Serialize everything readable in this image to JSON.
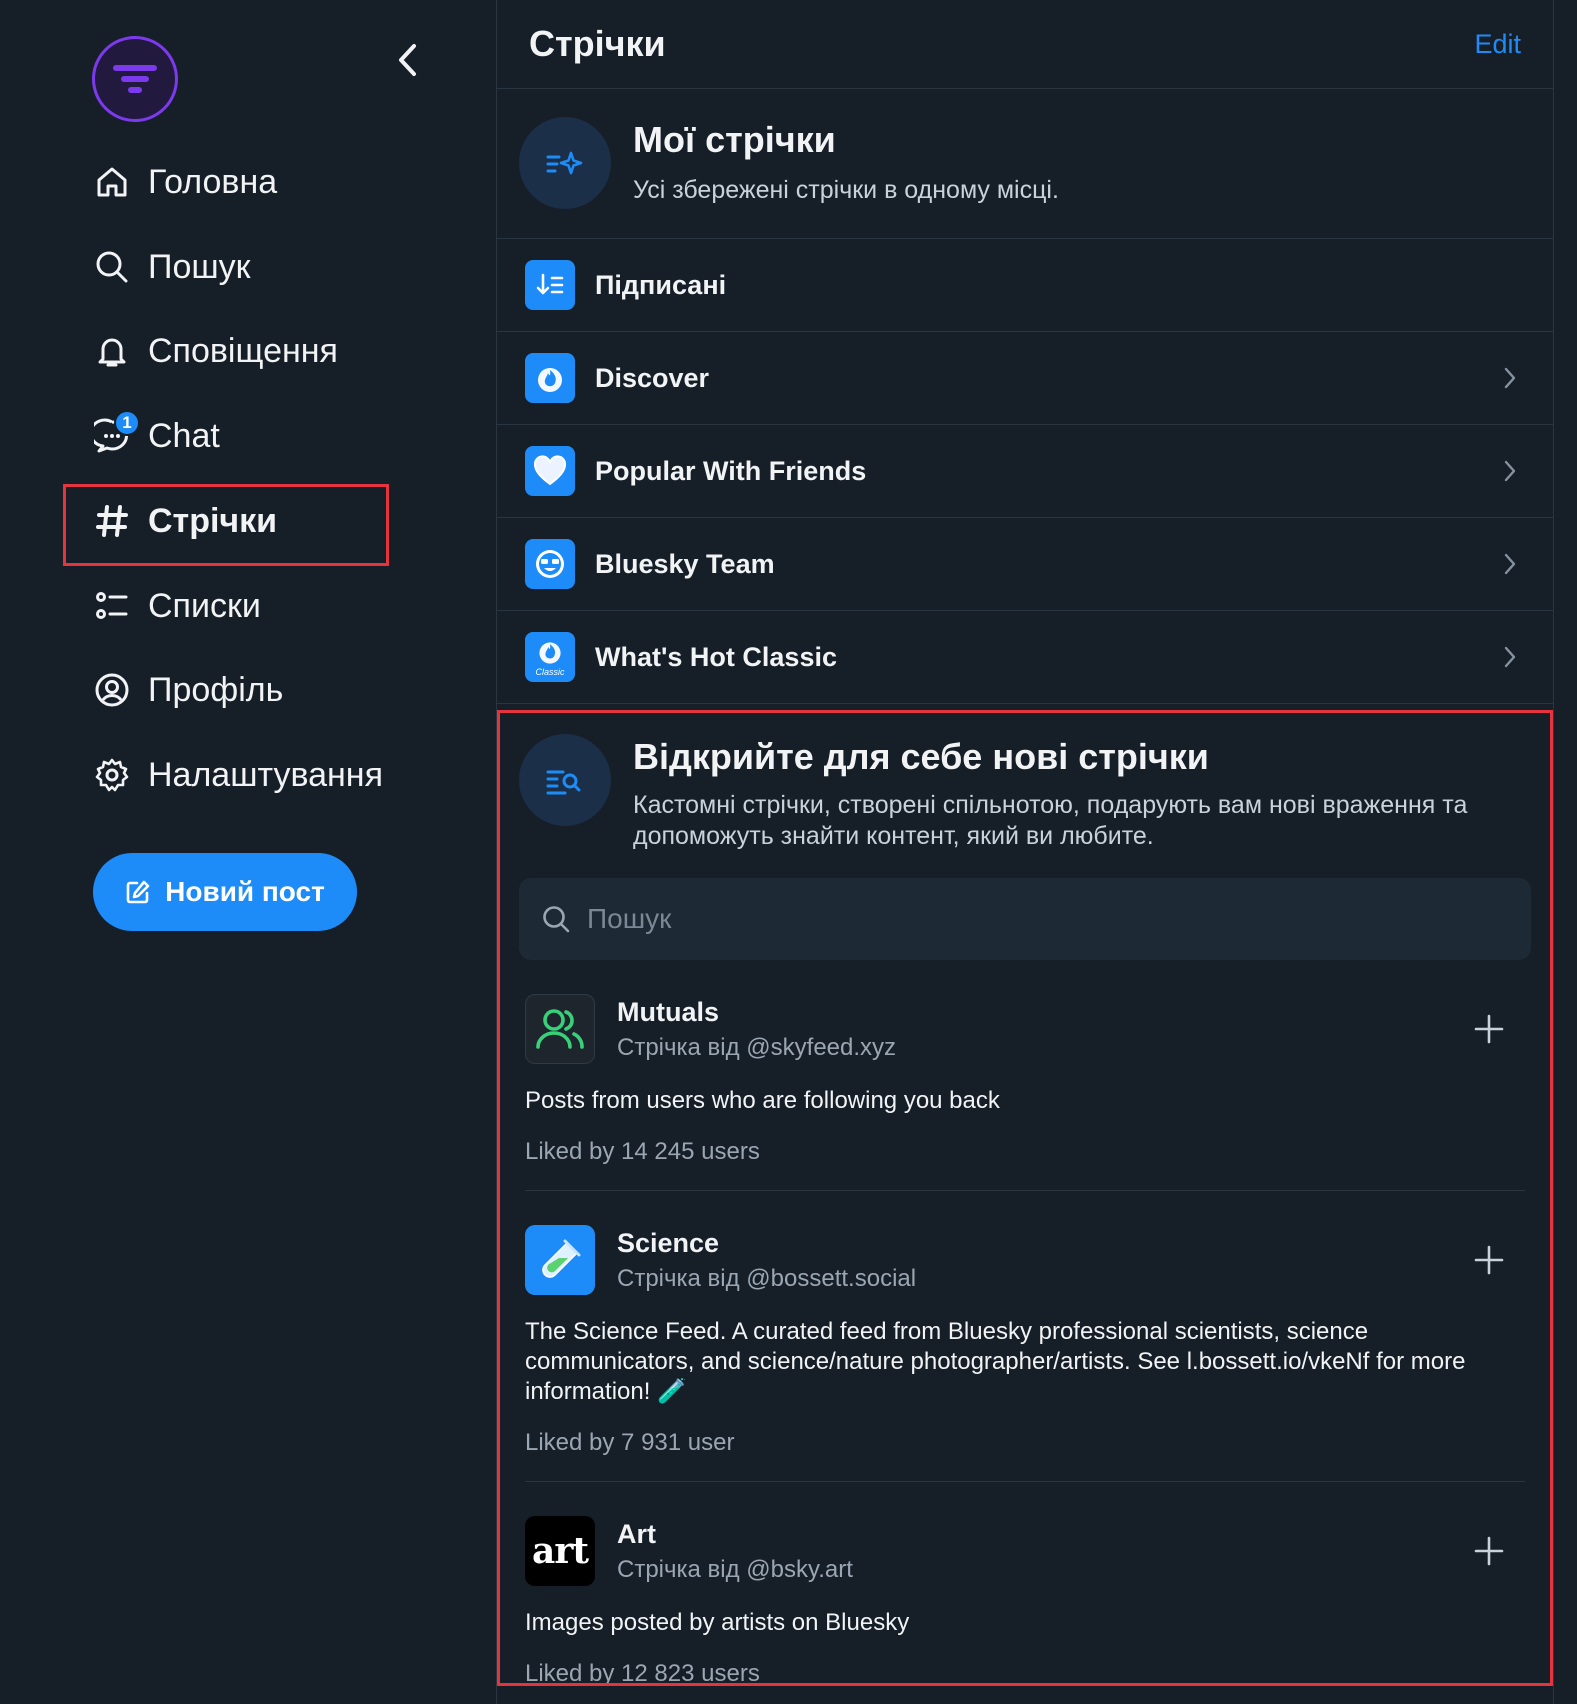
{
  "nav": {
    "home": "Головна",
    "search": "Пошук",
    "notifications": "Сповіщення",
    "chat": "Chat",
    "chat_badge": "1",
    "feeds": "Стрічки",
    "lists": "Списки",
    "profile": "Профіль",
    "settings": "Налаштування"
  },
  "new_post": "Новий пост",
  "header": {
    "title": "Стрічки",
    "edit": "Edit"
  },
  "my_feeds": {
    "title": "Мої стрічки",
    "subtitle": "Усі збережені стрічки в одному місці.",
    "items": [
      {
        "name": "Підписані",
        "icon": "following-icon",
        "chevron": false
      },
      {
        "name": "Discover",
        "icon": "discover-flame-icon",
        "chevron": true
      },
      {
        "name": "Popular With Friends",
        "icon": "heart-icon",
        "chevron": true
      },
      {
        "name": "Bluesky Team",
        "icon": "bluesky-team-icon",
        "chevron": true
      },
      {
        "name": "What's Hot Classic",
        "icon": "whats-hot-classic-icon",
        "icon_text": "Classic",
        "chevron": true
      }
    ]
  },
  "discover": {
    "title": "Відкрийте для себе нові стрічки",
    "subtitle": "Кастомні стрічки, створені спільнотою, подарують вам нові враження та допоможуть знайти контент, який ви любите.",
    "search_placeholder": "Пошук",
    "feeds": [
      {
        "name": "Mutuals",
        "by": "Стрічка від @skyfeed.xyz",
        "description": "Posts from users who are following you back",
        "likes": "Liked by 14 245 users"
      },
      {
        "name": "Science",
        "by": "Стрічка від @bossett.social",
        "description": "The Science Feed. A curated feed from Bluesky professional scientists,  science communicators, and science/nature photographer/artists. See l.bossett.io/vkeNf for more information! 🧪",
        "likes": "Liked by 7 931 user"
      },
      {
        "name": "Art",
        "by": "Стрічка від @bsky.art",
        "description": "Images posted by artists on Bluesky",
        "likes": "Liked by 12 823 users",
        "avatar_text": "art"
      }
    ]
  },
  "colors": {
    "accent": "#1d8cf8",
    "highlight": "#e5343d",
    "background": "#161e27"
  }
}
